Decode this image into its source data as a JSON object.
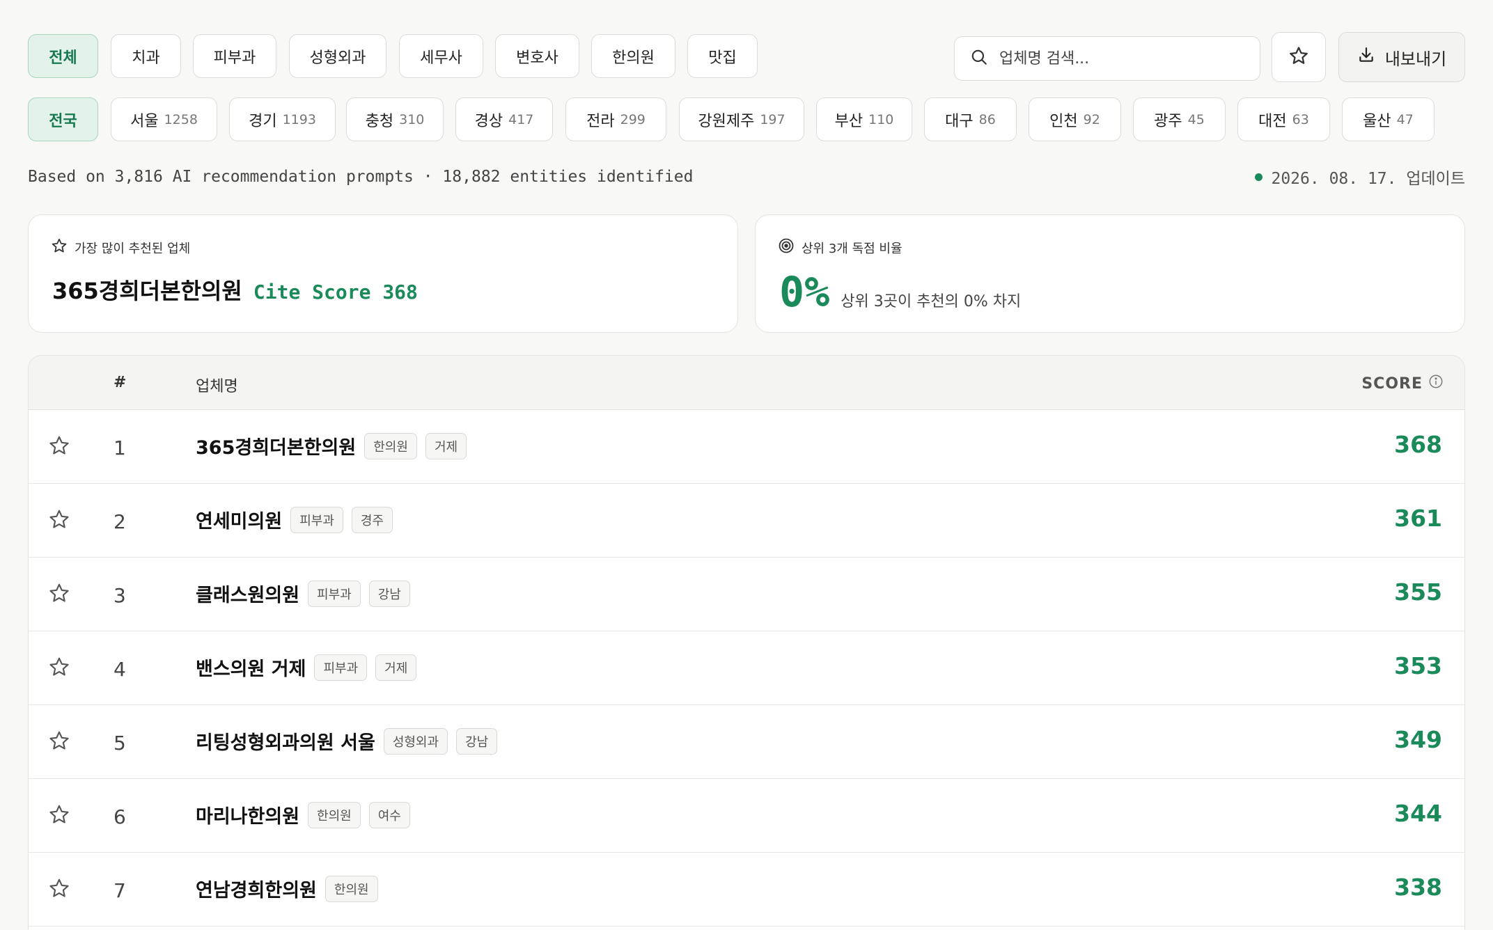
{
  "categories": [
    {
      "label": "전체",
      "active": true
    },
    {
      "label": "치과"
    },
    {
      "label": "피부과"
    },
    {
      "label": "성형외과"
    },
    {
      "label": "세무사"
    },
    {
      "label": "변호사"
    },
    {
      "label": "한의원"
    },
    {
      "label": "맛집"
    }
  ],
  "search": {
    "placeholder": "업체명 검색..."
  },
  "export_label": "내보내기",
  "regions": [
    {
      "label": "전국",
      "count": "",
      "active": true
    },
    {
      "label": "서울",
      "count": "1258"
    },
    {
      "label": "경기",
      "count": "1193"
    },
    {
      "label": "충청",
      "count": "310"
    },
    {
      "label": "경상",
      "count": "417"
    },
    {
      "label": "전라",
      "count": "299"
    },
    {
      "label": "강원제주",
      "count": "197"
    },
    {
      "label": "부산",
      "count": "110"
    },
    {
      "label": "대구",
      "count": "86"
    },
    {
      "label": "인천",
      "count": "92"
    },
    {
      "label": "광주",
      "count": "45"
    },
    {
      "label": "대전",
      "count": "63"
    },
    {
      "label": "울산",
      "count": "47"
    }
  ],
  "meta": {
    "basis": "Based on 3,816 AI recommendation prompts · 18,882 entities identified",
    "updated": "2026. 08. 17. 업데이트"
  },
  "top_card": {
    "label": "가장 많이 추천된 업체",
    "name": "365경희더본한의원",
    "cite": "Cite Score 368"
  },
  "share_card": {
    "label": "상위 3개 독점 비율",
    "value": "0%",
    "desc": "상위 3곳이 추천의 0% 차지"
  },
  "table": {
    "col_num": "#",
    "col_name": "업체명",
    "col_score": "SCORE",
    "rows": [
      {
        "rank": "1",
        "name": "365경희더본한의원",
        "tags": [
          "한의원",
          "거제"
        ],
        "score": "368"
      },
      {
        "rank": "2",
        "name": "연세미의원",
        "tags": [
          "피부과",
          "경주"
        ],
        "score": "361"
      },
      {
        "rank": "3",
        "name": "클래스원의원",
        "tags": [
          "피부과",
          "강남"
        ],
        "score": "355"
      },
      {
        "rank": "4",
        "name": "밴스의원 거제",
        "tags": [
          "피부과",
          "거제"
        ],
        "score": "353"
      },
      {
        "rank": "5",
        "name": "리팅성형외과의원 서울",
        "tags": [
          "성형외과",
          "강남"
        ],
        "score": "349"
      },
      {
        "rank": "6",
        "name": "마리나한의원",
        "tags": [
          "한의원",
          "여수"
        ],
        "score": "344"
      },
      {
        "rank": "7",
        "name": "연남경희한의원",
        "tags": [
          "한의원"
        ],
        "score": "338"
      }
    ]
  },
  "colors": {
    "accent": "#1b8a5a",
    "accent_bg": "#e3f2ea"
  }
}
